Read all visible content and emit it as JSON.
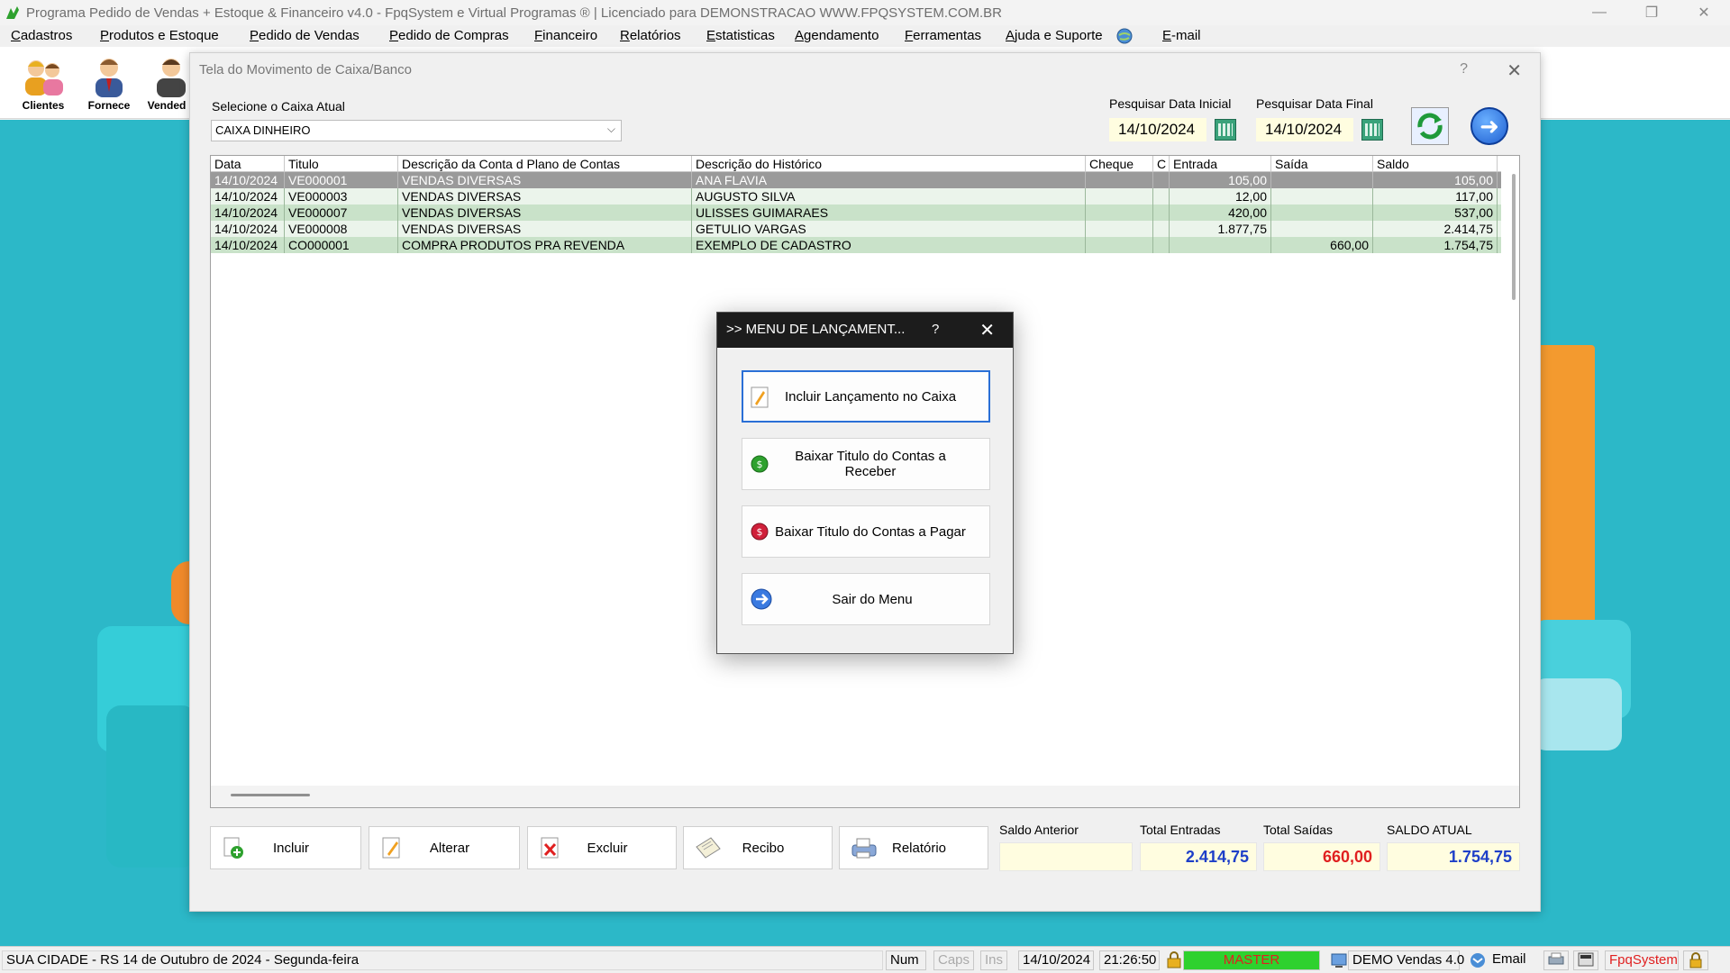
{
  "window": {
    "title": "Programa Pedido de Vendas + Estoque & Financeiro v4.0 - FpqSystem e Virtual Programas ® | Licenciado para  DEMONSTRACAO WWW.FPQSYSTEM.COM.BR",
    "minimize_glyph": "—",
    "restore_glyph": "❐",
    "close_glyph": "✕"
  },
  "menu": {
    "cadastros": "Cadastros",
    "produtos": "Produtos e Estoque",
    "pedido_vendas": "Pedido de Vendas",
    "pedido_compras": "Pedido de Compras",
    "financeiro": "Financeiro",
    "relatorios": "Relatórios",
    "estatisticas": "Estatisticas",
    "agendamento": "Agendamento",
    "ferramentas": "Ferramentas",
    "ajuda": "Ajuda e Suporte",
    "email": "E-mail"
  },
  "toolbar": {
    "clientes": "Clientes",
    "fornece": "Fornece",
    "vended": "Vended"
  },
  "caixa_window": {
    "title": "Tela do Movimento de Caixa/Banco",
    "help_glyph": "?",
    "close_glyph": "✕",
    "select_label": "Selecione o Caixa Atual",
    "select_value": "CAIXA DINHEIRO",
    "date_initial_label": "Pesquisar Data Inicial",
    "date_initial_value": "14/10/2024",
    "date_final_label": "Pesquisar Data Final",
    "date_final_value": "14/10/2024",
    "next_glyph": "➜"
  },
  "grid": {
    "headers": {
      "data": "Data",
      "titulo": "Titulo",
      "conta": "Descrição da Conta d Plano de Contas",
      "historico": "Descrição do Histórico",
      "cheque": "Cheque",
      "c": "C",
      "entrada": "Entrada",
      "saida": "Saída",
      "saldo": "Saldo"
    },
    "rows": [
      {
        "data": "14/10/2024",
        "titulo": "VE000001",
        "conta": "VENDAS DIVERSAS",
        "historico": "ANA FLAVIA",
        "cheque": "",
        "c": "",
        "entrada": "105,00",
        "saida": "",
        "saldo": "105,00"
      },
      {
        "data": "14/10/2024",
        "titulo": "VE000003",
        "conta": "VENDAS DIVERSAS",
        "historico": "AUGUSTO SILVA",
        "cheque": "",
        "c": "",
        "entrada": "12,00",
        "saida": "",
        "saldo": "117,00"
      },
      {
        "data": "14/10/2024",
        "titulo": "VE000007",
        "conta": "VENDAS DIVERSAS",
        "historico": "ULISSES GUIMARAES",
        "cheque": "",
        "c": "",
        "entrada": "420,00",
        "saida": "",
        "saldo": "537,00"
      },
      {
        "data": "14/10/2024",
        "titulo": "VE000008",
        "conta": "VENDAS DIVERSAS",
        "historico": "GETULIO VARGAS",
        "cheque": "",
        "c": "",
        "entrada": "1.877,75",
        "saida": "",
        "saldo": "2.414,75"
      },
      {
        "data": "14/10/2024",
        "titulo": "CO000001",
        "conta": "COMPRA PRODUTOS PRA REVENDA",
        "historico": "EXEMPLO DE CADASTRO",
        "cheque": "",
        "c": "",
        "entrada": "",
        "saida": "660,00",
        "saldo": "1.754,75"
      }
    ]
  },
  "buttons": {
    "incluir": "Incluir",
    "alterar": "Alterar",
    "excluir": "Excluir",
    "recibo": "Recibo",
    "relatorio": "Relatório"
  },
  "totals": {
    "saldo_anterior_label": "Saldo Anterior",
    "saldo_anterior_value": "",
    "total_entradas_label": "Total Entradas",
    "total_entradas_value": "2.414,75",
    "total_saidas_label": "Total Saídas",
    "total_saidas_value": "660,00",
    "saldo_atual_label": "SALDO ATUAL",
    "saldo_atual_value": "1.754,75"
  },
  "modal": {
    "title": ">> MENU DE LANÇAMENT...",
    "help_glyph": "?",
    "close_glyph": "✕",
    "incluir": "Incluir Lançamento no Caixa",
    "receber": "Baixar Titulo do Contas a Receber",
    "pagar": "Baixar Titulo do Contas a Pagar",
    "sair": "Sair do Menu"
  },
  "status": {
    "location": "SUA CIDADE - RS 14 de Outubro de 2024 - Segunda-feira",
    "num": "Num",
    "caps": "Caps",
    "ins": "Ins",
    "date": "14/10/2024",
    "time": "21:26:50",
    "user": "MASTER",
    "version": "DEMO Vendas 4.0",
    "email": "Email",
    "brand": "FpqSystem"
  },
  "colors": {
    "accent_blue": "#2a6fd6",
    "selected_row": "#9a9a9a",
    "green_row": "#c9e2c9",
    "total_red": "#e02020",
    "total_blue": "#1e3fc8",
    "master_green": "#2ed12e"
  }
}
